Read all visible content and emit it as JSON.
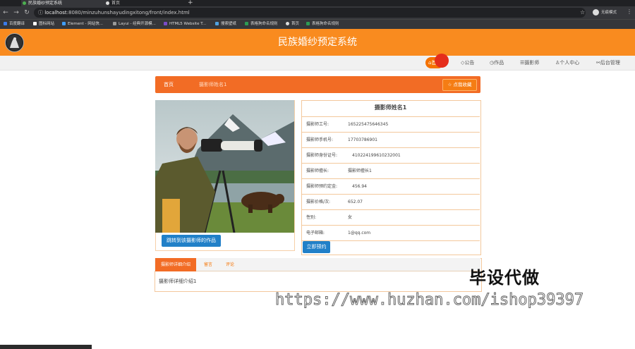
{
  "browser": {
    "tabs": [
      {
        "label": "民族婚纱预定系统",
        "active": true
      },
      {
        "label": "首页",
        "active": false
      }
    ],
    "url_host": "localhost",
    "url_rest": ":8080/minzuhunshayudingxitong/front/index.html",
    "profile_label": "无痕模式",
    "bookmarks": [
      "百度翻译",
      "图标网站",
      "Element - 网站快...",
      "Layui - 经典开源模...",
      "HTML5 Website T...",
      "搜索壁纸",
      "表格狗命名规则",
      "首页",
      "表格狗命名规则"
    ]
  },
  "site": {
    "title": "民族婚纱预定系统",
    "nav": [
      "首页",
      "公告",
      "作品",
      "摄影师",
      "个人中心",
      "后台管理"
    ]
  },
  "breadcrumb": {
    "home": "首页",
    "current": "摄影师姓名1",
    "favorite_label": "☆ 点我收藏"
  },
  "photographer": {
    "name": "摄影师姓名1",
    "fields": [
      {
        "label": "摄影师工号:",
        "value": "165225475646345"
      },
      {
        "label": "摄影师手机号:",
        "value": "17703786901"
      },
      {
        "label": "摄影师身份证号:",
        "value": "410224199610232001"
      },
      {
        "label": "摄影师擅长:",
        "value": "摄影师擅长1"
      },
      {
        "label": "摄影师预约定金:",
        "value": "456.94"
      },
      {
        "label": "摄影价格/次:",
        "value": "652.07"
      },
      {
        "label": "性别:",
        "value": "女"
      },
      {
        "label": "电子邮箱:",
        "value": "1@qq.com"
      }
    ],
    "works_button": "跳转到该摄影师的作品",
    "book_button": "立即预约"
  },
  "detail_tabs": {
    "items": [
      "摄影师详细介绍",
      "留言",
      "评论"
    ],
    "content": "摄影师详细介绍1"
  },
  "watermark": {
    "line1": "毕设代做",
    "line2": "https://www.huzhan.com/ishop39397"
  },
  "colors": {
    "header": "#f98b1f",
    "accent": "#f26c25",
    "button_blue": "#2180c8"
  }
}
